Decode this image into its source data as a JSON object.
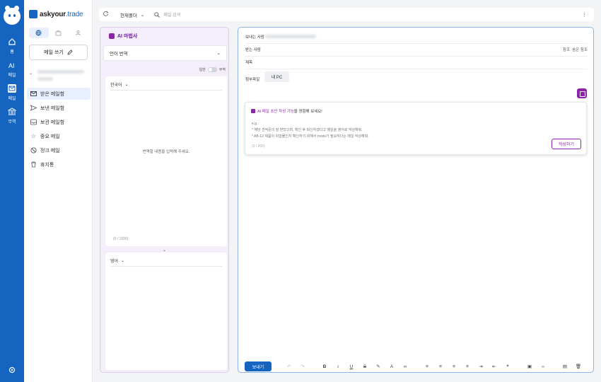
{
  "rail": {
    "items": [
      {
        "label": "홈",
        "icon": "home-icon"
      },
      {
        "label": "메일",
        "icon": "mail-icon"
      },
      {
        "label": "무역",
        "icon": "bank-icon"
      }
    ],
    "ai_label": "메일",
    "ai_title": "AI",
    "settings_icon": "settings-icon"
  },
  "brand": {
    "name": "askyour",
    "tld": ".trade"
  },
  "sidebar": {
    "compose_label": "메일 쓰기",
    "folders": [
      {
        "label": "받은 메일함",
        "icon": "inbox-icon"
      },
      {
        "label": "보낸 메일함",
        "icon": "send-icon"
      },
      {
        "label": "보관 메일함",
        "icon": "archive-icon"
      },
      {
        "label": "중요 메일",
        "icon": "star-icon"
      },
      {
        "label": "정크 메일",
        "icon": "block-icon"
      },
      {
        "label": "휴지통",
        "icon": "trash-icon"
      }
    ]
  },
  "topbar": {
    "folder_select": "현재폴더",
    "search_placeholder": "메일 검색"
  },
  "ai_panel": {
    "title": "AI 마법사",
    "mode_select": "언어 번역",
    "toggle_left": "일반",
    "toggle_right": "무역",
    "source_lang": "한국어",
    "placeholder": "번역할 내용을 입력해 주세요.",
    "char_count": "(0 / 1500)",
    "target_lang": "영어"
  },
  "compose": {
    "from_label": "보내는 사람",
    "to_label": "받는 사람",
    "cc": "참조",
    "bcc": "숨은 참조",
    "subject_label": "제목",
    "attach_label": "첨부파일",
    "attach_button": "내 PC",
    "draft": {
      "title_highlight": "AI 메일 초안 작성 기능",
      "title_rest": "을 경험해 보세요!",
      "eg": "e.g.",
      "line1": "* 해당 견적문의 잘 받았으며, 확인 후 회신하겠다고 메일을 영어로 작성해줘.",
      "line2": "* AB-12 제품이 위험물인지 확인하기 위해서 msds가 필요하다는 메일 작성해줘.",
      "count": "(0 / 200)",
      "button": "작성하기"
    },
    "send_button": "보내기"
  },
  "colors": {
    "primary": "#1565c0",
    "ai_purple": "#8e24aa"
  }
}
